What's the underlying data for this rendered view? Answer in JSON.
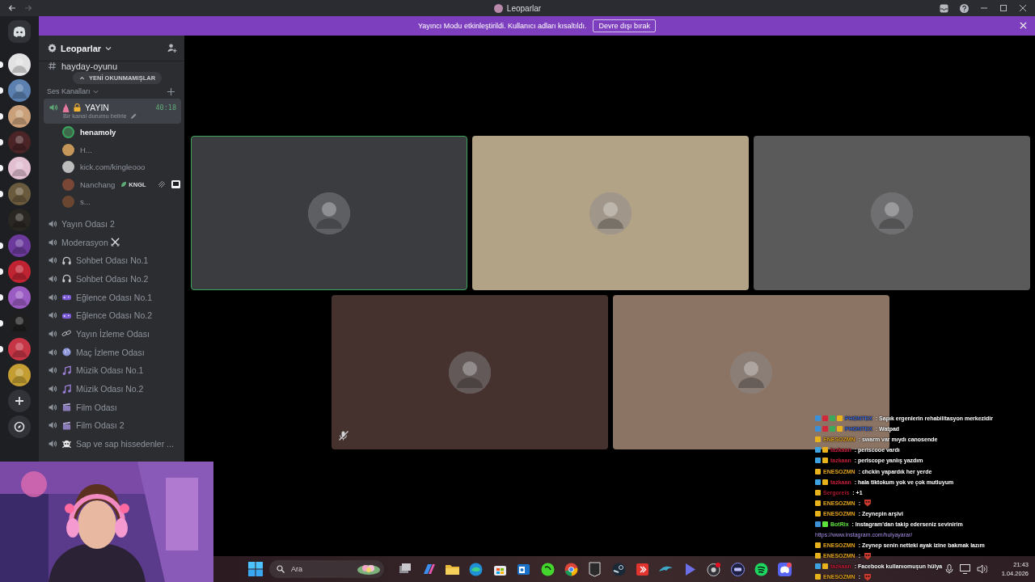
{
  "window": {
    "title": "Leoparlar"
  },
  "servers": [
    {
      "color": "#e2e2e2",
      "unread": true
    },
    {
      "color": "#5b7fae",
      "unread": true
    },
    {
      "color": "#c9a07a",
      "unread": true
    },
    {
      "color": "#4a2426",
      "unread": true
    },
    {
      "color": "#e3bfd2",
      "unread": true
    },
    {
      "color": "#6a5a3e",
      "unread": true
    },
    {
      "color": "#2a2622",
      "unread": false
    },
    {
      "color": "#6b3a9c",
      "unread": true
    },
    {
      "color": "#c02433",
      "unread": true
    },
    {
      "color": "#9a5bc2",
      "unread": true
    },
    {
      "color": "#1f1f1f",
      "unread": true
    },
    {
      "color": "#c63546",
      "unread": true
    },
    {
      "color": "#c49d33",
      "unread": false
    }
  ],
  "banner": {
    "text": "Yayıncı Modu etkinleştirildi. Kullanıcı adları kısaltıldı.",
    "button": "Devre dışı bırak"
  },
  "server_header": {
    "name": "Leoparlar"
  },
  "text_channel": {
    "name": "hayday-oyunu"
  },
  "unread_pill": "YENİ OKUNMAMIŞLAR",
  "category": {
    "name": "Ses Kanalları"
  },
  "active_channel": {
    "name": "YAYIN",
    "timer": "40:18",
    "status": "Bir kanal durumu belirle",
    "selected": true
  },
  "voice_users": [
    {
      "name": "henamoly",
      "speaking": true,
      "color": "#3d6a4b",
      "muted": false,
      "streaming": false
    },
    {
      "name": "H...",
      "speaking": false,
      "color": "#c4965a",
      "muted": false,
      "streaming": false
    },
    {
      "name": "kick.com/kingleooo",
      "speaking": false,
      "color": "#bcbcbc",
      "muted": false,
      "streaming": false
    },
    {
      "name": "Nanchang",
      "tag": "KNGL",
      "speaking": false,
      "color": "#7a4636",
      "muted": true,
      "streaming": true
    },
    {
      "name": "s...",
      "speaking": false,
      "color": "#6a4630",
      "muted": false,
      "streaming": false
    }
  ],
  "channels": [
    {
      "name": "Yayın Odası 2",
      "kind": "plain"
    },
    {
      "name": "Moderasyon",
      "kind": "swords"
    },
    {
      "name": "Sohbet Odası No.1",
      "kind": "headphones"
    },
    {
      "name": "Sohbet Odası No.2",
      "kind": "headphones"
    },
    {
      "name": "Eğlence Odası No.1",
      "kind": "gamepad"
    },
    {
      "name": "Eğlence Odası No.2",
      "kind": "gamepad"
    },
    {
      "name": "Yayın İzleme Odası",
      "kind": "link"
    },
    {
      "name": "Maç İzleme Odası",
      "kind": "globe"
    },
    {
      "name": "Müzik Odası No.1",
      "kind": "music"
    },
    {
      "name": "Müzik Odası No.2",
      "kind": "music"
    },
    {
      "name": "Film Odası",
      "kind": "film"
    },
    {
      "name": "Film Odası 2",
      "kind": "film"
    },
    {
      "name": "Sap ve sap hissedenler ...",
      "kind": "skull"
    }
  ],
  "tiles": [
    {
      "color": "#3b3c40",
      "speaking": true,
      "muted": false
    },
    {
      "color": "#b3a386",
      "speaking": false,
      "muted": false
    },
    {
      "color": "#5a5a5a",
      "speaking": false,
      "muted": false
    },
    {
      "color": "#45322e",
      "speaking": false,
      "muted": true
    },
    {
      "color": "#8c7464",
      "speaking": false,
      "muted": false
    }
  ],
  "chat": [
    {
      "kind": "text",
      "name": "PHONTEX",
      "color": "#3a64cf",
      "badges": [
        {
          "color": "#3d8fd6"
        },
        {
          "color": "#d2283c"
        },
        {
          "color": "#3ca85a"
        },
        {
          "color": "#e8b21c"
        }
      ],
      "text": ": Sapık ergenlerin rehabilitasyon merkezidir"
    },
    {
      "kind": "text",
      "name": "PHONTEX",
      "color": "#3a64cf",
      "badges": [
        {
          "color": "#3d8fd6"
        },
        {
          "color": "#d2283c"
        },
        {
          "color": "#3ca85a"
        },
        {
          "color": "#e8b21c"
        }
      ],
      "text": ": Watpad"
    },
    {
      "kind": "text",
      "name": "ENESOZMN",
      "color": "#e0a21e",
      "badges": [
        {
          "color": "#e8b21c"
        }
      ],
      "text": ": swarm var mıydı canosende"
    },
    {
      "kind": "text",
      "name": "tazkaan",
      "color": "#c21f3a",
      "badges": [
        {
          "color": "#3da2e0"
        },
        {
          "color": "#e8b21c"
        }
      ],
      "text": ": periscooe vardı"
    },
    {
      "kind": "text",
      "name": "tazkaan",
      "color": "#c21f3a",
      "badges": [
        {
          "color": "#3da2e0"
        },
        {
          "color": "#e8b21c"
        }
      ],
      "text": ": periscope yanlış yazdım"
    },
    {
      "kind": "text",
      "name": "ENESOZMN",
      "color": "#e0a21e",
      "badges": [
        {
          "color": "#e8b21c"
        }
      ],
      "text": ": chckin yapardık her yerde"
    },
    {
      "kind": "text",
      "name": "tazkaan",
      "color": "#c21f3a",
      "badges": [
        {
          "color": "#3da2e0"
        },
        {
          "color": "#e8b21c"
        }
      ],
      "text": ": hala tiktokum yok ve çok mutluyum"
    },
    {
      "kind": "text",
      "name": "Sergoreis",
      "color": "#a8182e",
      "badges": [
        {
          "color": "#e8b21c"
        }
      ],
      "text": ": +1"
    },
    {
      "kind": "emote",
      "name": "ENESOZMN",
      "color": "#e0a21e",
      "badges": [
        {
          "color": "#e8b21c"
        }
      ],
      "text": ":"
    },
    {
      "kind": "text",
      "name": "ENESOZMN",
      "color": "#e0a21e",
      "badges": [
        {
          "color": "#e8b21c"
        }
      ],
      "text": ": Zeynepin arşivi"
    },
    {
      "kind": "text",
      "name": "BotRix",
      "color": "#5ee23c",
      "badges": [
        {
          "color": "#3d8fd6"
        },
        {
          "color": "#5ee23c"
        }
      ],
      "text": ": Instagram'dan takip ederseniz sevinirim"
    },
    {
      "kind": "link",
      "text": "https://www.instagram.com/hulyayarar/"
    },
    {
      "kind": "text",
      "name": "ENESOZMN",
      "color": "#e0a21e",
      "badges": [
        {
          "color": "#e8b21c"
        }
      ],
      "text": ": Zeynep senin netteki ayak izine bakmak lazım"
    },
    {
      "kind": "emote",
      "name": "ENESOZMN",
      "color": "#e0a21e",
      "badges": [
        {
          "color": "#e8b21c"
        }
      ],
      "text": ":"
    },
    {
      "kind": "text",
      "name": "tazkaan",
      "color": "#c21f3a",
      "badges": [
        {
          "color": "#3da2e0"
        },
        {
          "color": "#e8b21c"
        }
      ],
      "text": ": Facebook kullanıomuşun hülya"
    },
    {
      "kind": "emote",
      "name": "ENESOZMN",
      "color": "#e0a21e",
      "badges": [
        {
          "color": "#e8b21c"
        }
      ],
      "text": ":"
    }
  ],
  "taskbar": {
    "search_placeholder": "Ara",
    "time": "21:43",
    "date": "1.04.2026"
  }
}
